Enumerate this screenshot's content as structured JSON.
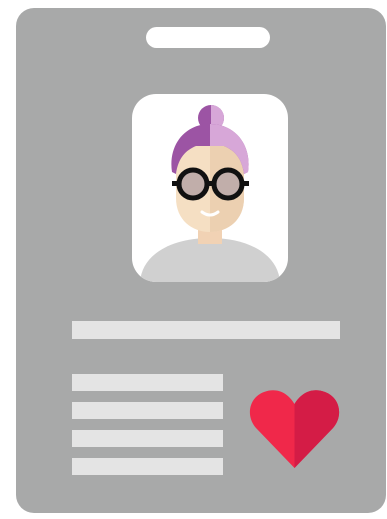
{
  "badge": {
    "photo_icon": "user-avatar-woman-purple-hair-glasses",
    "heart_icon": "heart-icon",
    "colors": {
      "card": "#a8a9a9",
      "bar": "#e4e4e4",
      "hair": "#9c54a4",
      "heart": "#f0284a"
    }
  }
}
